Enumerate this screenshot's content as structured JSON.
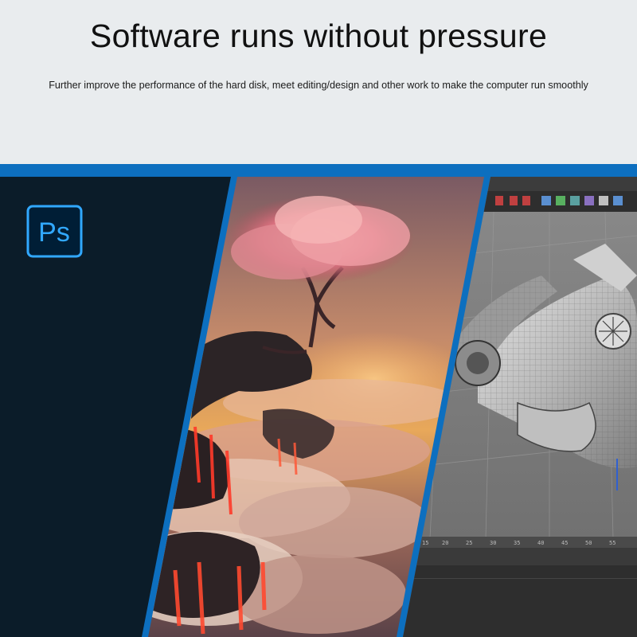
{
  "header": {
    "title": "Software runs without pressure",
    "subtitle": "Further improve the performance of the hard disk, meet editing/design and other work to make the computer run smoothly"
  },
  "banner": {
    "ps_logo": {
      "icon": "photoshop-logo-icon",
      "text": "Ps"
    },
    "panels": [
      {
        "icon": "photoshop-panel",
        "description_key": "dark-app-panel"
      },
      {
        "icon": "fantasy-tree-artwork",
        "description_key": "artwork-panel"
      },
      {
        "icon": "3d-modeling-viewport",
        "description_key": "cinema4d-panel"
      }
    ]
  },
  "colors": {
    "page_background": "#e9ecee",
    "banner_blue": "#0d6fbf",
    "ps_dark": "#0b1c29",
    "ps_accent": "#31a8ff"
  }
}
